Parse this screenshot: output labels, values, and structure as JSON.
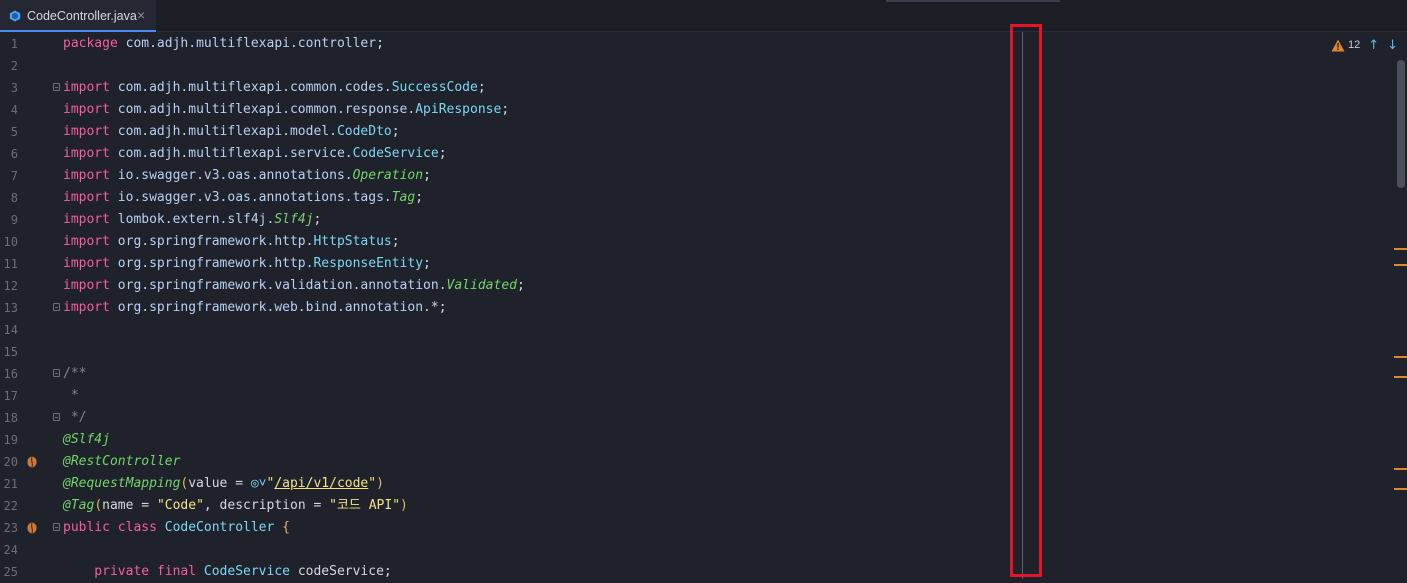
{
  "tab": {
    "filename": "CodeController.java",
    "close_glyph": "×",
    "icon": "java-class-icon",
    "accent": "#4a8cf0"
  },
  "inspections": {
    "warnings_count": "12",
    "warning_icon": "warning-triangle-icon",
    "prev_glyph": "↑",
    "next_glyph": "↓"
  },
  "lines": [
    {
      "n": "1",
      "tokens": [
        {
          "t": "package ",
          "c": "kw"
        },
        {
          "t": "com.adjh.multiflexapi.controller",
          "c": "pkg"
        },
        {
          "t": ";",
          "c": "plain"
        }
      ]
    },
    {
      "n": "2",
      "tokens": []
    },
    {
      "n": "3",
      "fold": true,
      "tokens": [
        {
          "t": "import ",
          "c": "kw"
        },
        {
          "t": "com.adjh.multiflexapi.common.codes.",
          "c": "pkg"
        },
        {
          "t": "SuccessCode",
          "c": "cls"
        },
        {
          "t": ";",
          "c": "plain"
        }
      ]
    },
    {
      "n": "4",
      "tokens": [
        {
          "t": "import ",
          "c": "kw"
        },
        {
          "t": "com.adjh.multiflexapi.common.response.",
          "c": "pkg"
        },
        {
          "t": "ApiResponse",
          "c": "cls"
        },
        {
          "t": ";",
          "c": "plain"
        }
      ]
    },
    {
      "n": "5",
      "tokens": [
        {
          "t": "import ",
          "c": "kw"
        },
        {
          "t": "com.adjh.multiflexapi.model.",
          "c": "pkg"
        },
        {
          "t": "CodeDto",
          "c": "cls"
        },
        {
          "t": ";",
          "c": "plain"
        }
      ]
    },
    {
      "n": "6",
      "tokens": [
        {
          "t": "import ",
          "c": "kw"
        },
        {
          "t": "com.adjh.multiflexapi.service.",
          "c": "pkg"
        },
        {
          "t": "CodeService",
          "c": "cls"
        },
        {
          "t": ";",
          "c": "plain"
        }
      ]
    },
    {
      "n": "7",
      "tokens": [
        {
          "t": "import ",
          "c": "kw"
        },
        {
          "t": "io.swagger.v3.oas.annotations.",
          "c": "pkg"
        },
        {
          "t": "Operation",
          "c": "ann"
        },
        {
          "t": ";",
          "c": "plain"
        }
      ]
    },
    {
      "n": "8",
      "tokens": [
        {
          "t": "import ",
          "c": "kw"
        },
        {
          "t": "io.swagger.v3.oas.annotations.tags.",
          "c": "pkg"
        },
        {
          "t": "Tag",
          "c": "ann"
        },
        {
          "t": ";",
          "c": "plain"
        }
      ]
    },
    {
      "n": "9",
      "tokens": [
        {
          "t": "import ",
          "c": "kw"
        },
        {
          "t": "lombok.extern.slf4j.",
          "c": "pkg"
        },
        {
          "t": "Slf4j",
          "c": "ann"
        },
        {
          "t": ";",
          "c": "plain"
        }
      ]
    },
    {
      "n": "10",
      "tokens": [
        {
          "t": "import ",
          "c": "kw"
        },
        {
          "t": "org.springframework.http.",
          "c": "pkg"
        },
        {
          "t": "HttpStatus",
          "c": "cls"
        },
        {
          "t": ";",
          "c": "plain"
        }
      ]
    },
    {
      "n": "11",
      "tokens": [
        {
          "t": "import ",
          "c": "kw"
        },
        {
          "t": "org.springframework.http.",
          "c": "pkg"
        },
        {
          "t": "ResponseEntity",
          "c": "cls"
        },
        {
          "t": ";",
          "c": "plain"
        }
      ]
    },
    {
      "n": "12",
      "tokens": [
        {
          "t": "import ",
          "c": "kw"
        },
        {
          "t": "org.springframework.validation.annotation.",
          "c": "pkg"
        },
        {
          "t": "Validated",
          "c": "ann"
        },
        {
          "t": ";",
          "c": "plain"
        }
      ]
    },
    {
      "n": "13",
      "fold": true,
      "tokens": [
        {
          "t": "import ",
          "c": "kw"
        },
        {
          "t": "org.springframework.web.bind.annotation.",
          "c": "pkg"
        },
        {
          "t": "*",
          "c": "plain"
        },
        {
          "t": ";",
          "c": "plain"
        }
      ]
    },
    {
      "n": "14",
      "tokens": []
    },
    {
      "n": "15",
      "tokens": []
    },
    {
      "n": "16",
      "fold": true,
      "tokens": [
        {
          "t": "/**",
          "c": "cmt"
        }
      ]
    },
    {
      "n": "17",
      "tokens": [
        {
          "t": " *",
          "c": "cmt"
        }
      ]
    },
    {
      "n": "18",
      "fold": true,
      "tokens": [
        {
          "t": " */",
          "c": "cmt"
        }
      ]
    },
    {
      "n": "19",
      "tokens": [
        {
          "t": "@Slf4j",
          "c": "ann"
        }
      ]
    },
    {
      "n": "20",
      "bean": true,
      "tokens": [
        {
          "t": "@RestController",
          "c": "ann"
        }
      ]
    },
    {
      "n": "21",
      "tokens": [
        {
          "t": "@RequestMapping",
          "c": "ann"
        },
        {
          "t": "(",
          "c": "brk"
        },
        {
          "t": "value = ",
          "c": "plain"
        },
        {
          "t": "◎˅",
          "c": "cls"
        },
        {
          "t": "\"",
          "c": "str"
        },
        {
          "t": "/api/v1/code",
          "c": "strl"
        },
        {
          "t": "\"",
          "c": "str"
        },
        {
          "t": ")",
          "c": "brk"
        }
      ]
    },
    {
      "n": "22",
      "tokens": [
        {
          "t": "@Tag",
          "c": "ann"
        },
        {
          "t": "(",
          "c": "brk"
        },
        {
          "t": "name = ",
          "c": "plain"
        },
        {
          "t": "\"Code\"",
          "c": "str"
        },
        {
          "t": ", description = ",
          "c": "plain"
        },
        {
          "t": "\"코드 API\"",
          "c": "str"
        },
        {
          "t": ")",
          "c": "brk"
        }
      ]
    },
    {
      "n": "23",
      "bean": true,
      "fold": true,
      "tokens": [
        {
          "t": "public class ",
          "c": "kw"
        },
        {
          "t": "CodeController ",
          "c": "cls"
        },
        {
          "t": "{",
          "c": "brk"
        }
      ]
    },
    {
      "n": "24",
      "tokens": []
    },
    {
      "n": "25",
      "tokens": [
        {
          "t": "    private final ",
          "c": "kw"
        },
        {
          "t": "CodeService ",
          "c": "cls"
        },
        {
          "t": "codeService",
          "c": "plain"
        },
        {
          "t": ";",
          "c": "plain"
        }
      ]
    }
  ],
  "right_margin_guide": {
    "highlight": "red-box-annotation",
    "color": "#e5142a"
  },
  "error_stripe": {
    "marker_color": "#e0862a"
  }
}
